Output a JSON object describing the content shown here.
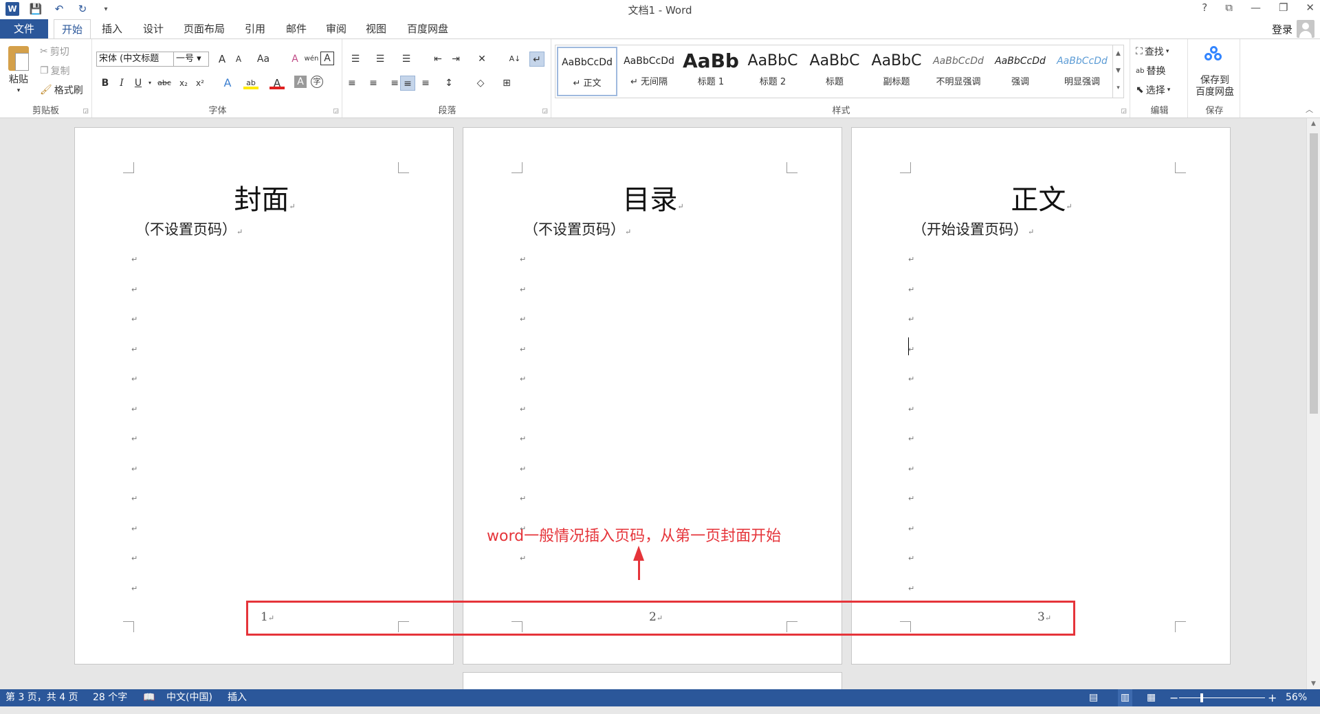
{
  "titlebar": {
    "title": "文档1 - Word",
    "qat": {
      "word_logo": "W",
      "save": "💾",
      "undo": "↶",
      "redo": "↻",
      "customize": "▾"
    },
    "help": "?",
    "ribbon_display": "⧉",
    "minimize": "—",
    "restore": "❐",
    "close": "✕"
  },
  "tabs": {
    "file": "文件",
    "home": "开始",
    "insert": "插入",
    "design": "设计",
    "layout": "页面布局",
    "references": "引用",
    "mailings": "邮件",
    "review": "审阅",
    "view": "视图",
    "baidu": "百度网盘",
    "login": "登录"
  },
  "ribbon": {
    "clipboard": {
      "label": "剪贴板",
      "paste": "粘贴",
      "cut": "剪切",
      "copy": "复制",
      "format_painter": "格式刷"
    },
    "font": {
      "label": "字体",
      "font_name": "宋体 (中文标题",
      "font_size": "一号",
      "grow": "A",
      "shrink": "A",
      "case": "Aa",
      "clear": "A",
      "phonetic": "wén",
      "border": "A",
      "bold": "B",
      "italic": "I",
      "underline": "U",
      "strike": "abc",
      "subscript": "x₂",
      "superscript": "x²",
      "effects": "A",
      "highlight": "ab",
      "font_color": "A",
      "shading": "A",
      "enclose": "字"
    },
    "paragraph": {
      "label": "段落",
      "bullets": "☰",
      "numbering": "☰",
      "multilevel": "☰",
      "outdent": "⇤",
      "indent": "⇥",
      "asian_layout": "✕",
      "sort": "A↓",
      "show_marks": "↵",
      "align_left": "≡",
      "center": "≡",
      "align_right": "≡",
      "justify": "≡",
      "distributed": "≡",
      "line_spacing": "↕",
      "shading": "◇",
      "borders": "⊞"
    },
    "styles": {
      "label": "样式",
      "items": [
        {
          "sample": "AaBbCcDd",
          "name": "↵ 正文"
        },
        {
          "sample": "AaBbCcDd",
          "name": "↵ 无间隔"
        },
        {
          "sample": "AaBb",
          "name": "标题 1"
        },
        {
          "sample": "AaBbC",
          "name": "标题 2"
        },
        {
          "sample": "AaBbC",
          "name": "标题"
        },
        {
          "sample": "AaBbC",
          "name": "副标题"
        },
        {
          "sample": "AaBbCcDd",
          "name": "不明显强调"
        },
        {
          "sample": "AaBbCcDd",
          "name": "强调"
        },
        {
          "sample": "AaBbCcDd",
          "name": "明显强调"
        }
      ],
      "scroll_up": "▲",
      "scroll_down": "▼",
      "more": "▾"
    },
    "editing": {
      "label": "编辑",
      "find": "查找",
      "replace": "替换",
      "select": "选择"
    },
    "save": {
      "label": "保存",
      "line1": "保存到",
      "line2": "百度网盘"
    },
    "collapse": "︿"
  },
  "document": {
    "pages": [
      {
        "title": "封面",
        "subtitle": "（不设置页码）",
        "page_number": "1"
      },
      {
        "title": "目录",
        "subtitle": "（不设置页码）",
        "page_number": "2"
      },
      {
        "title": "正文",
        "subtitle": "（开始设置页码）",
        "page_number": "3"
      }
    ],
    "para_mark": "↵",
    "annotation": "word一般情况插入页码，从第一页封面开始",
    "annotation_color": "#e5343a"
  },
  "statusbar": {
    "page": "第 3 页，共 4 页",
    "words": "28 个字",
    "language": "中文(中国)",
    "mode": "插入",
    "zoom": "56%",
    "zoom_minus": "−",
    "zoom_plus": "+"
  },
  "colors": {
    "brand": "#2b579a",
    "annotation": "#e5343a"
  }
}
